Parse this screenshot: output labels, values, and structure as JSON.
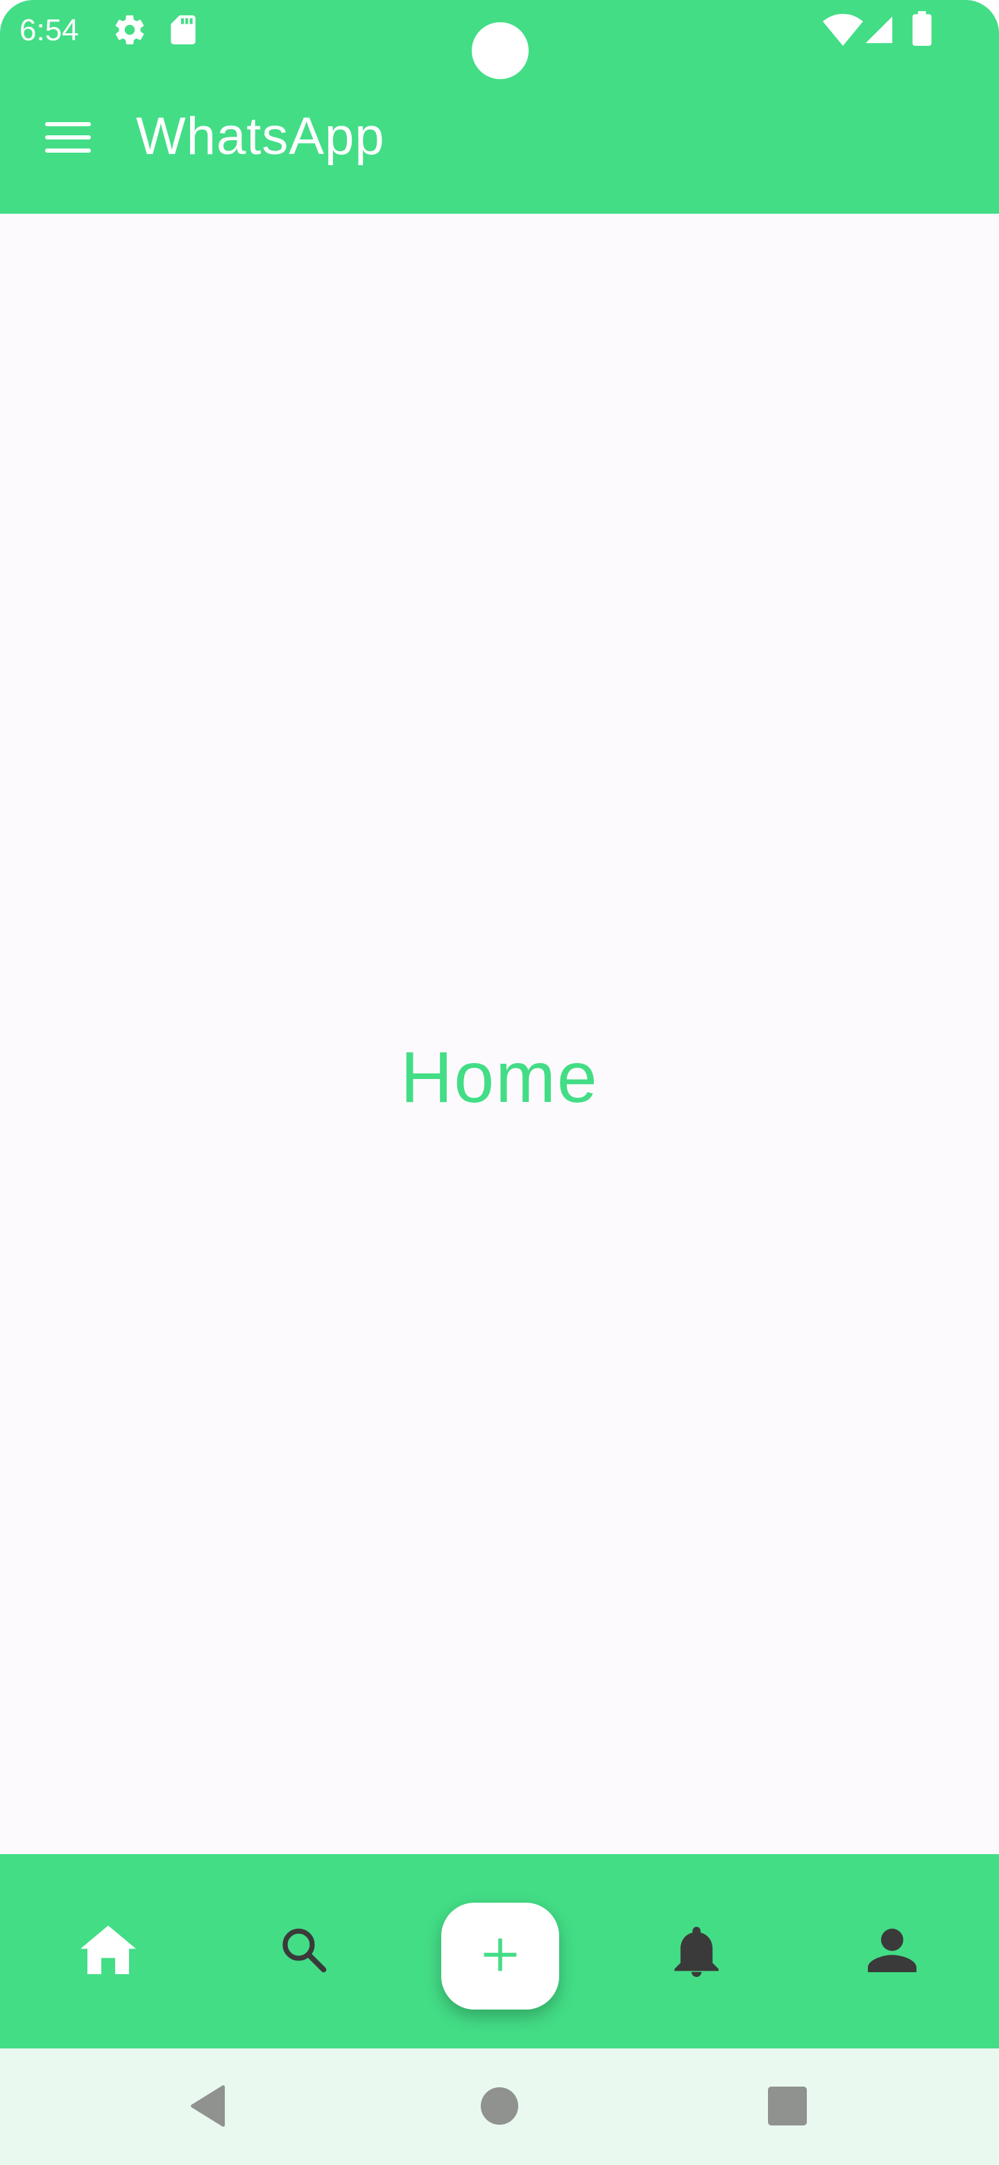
{
  "status_bar": {
    "time": "6:54",
    "icons": [
      "settings-gear-icon",
      "sd-card-icon",
      "wifi-icon",
      "cell-signal-icon",
      "battery-icon"
    ]
  },
  "app_bar": {
    "title": "WhatsApp",
    "menu_icon": "hamburger-menu-icon"
  },
  "main": {
    "label": "Home"
  },
  "bottom_nav": {
    "items": [
      {
        "icon": "home-icon",
        "active": true
      },
      {
        "icon": "search-icon",
        "active": false
      },
      {
        "icon": "add-icon",
        "fab": true
      },
      {
        "icon": "notifications-bell-icon",
        "active": false
      },
      {
        "icon": "profile-person-icon",
        "active": false
      }
    ]
  },
  "system_nav": {
    "buttons": [
      "back-icon",
      "home-circle-icon",
      "recents-square-icon"
    ]
  },
  "colors": {
    "primary": "#43dd86",
    "background": "#fdfafd",
    "icon_dark": "#3a3a3a",
    "system_nav_bg": "#eaf9f0"
  }
}
